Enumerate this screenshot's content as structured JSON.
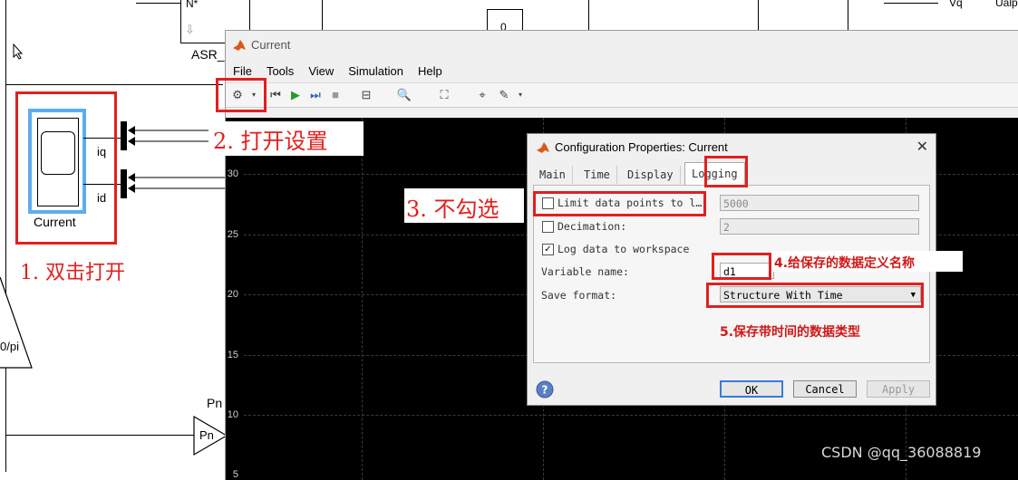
{
  "model": {
    "top_labels": {
      "n_port": "N*",
      "asr_label": "ASR_",
      "block_value": "0",
      "vq_port": "Vq",
      "ualpha": "Ualp"
    },
    "scope_block": {
      "label": "Current",
      "in_iq": "iq",
      "in_id": "id"
    },
    "gain_block": {
      "text": "0/pi"
    },
    "pn_block": {
      "label": "Pn",
      "text": "Pn"
    }
  },
  "scope_window": {
    "title": "Current",
    "menu": [
      "File",
      "Tools",
      "View",
      "Simulation",
      "Help"
    ],
    "yticks": [
      "30",
      "25",
      "20",
      "15",
      "10",
      "5"
    ]
  },
  "dialog": {
    "title": "Configuration Properties: Current",
    "tabs": [
      "Main",
      "Time",
      "Display",
      "Logging"
    ],
    "active_tab": "Logging",
    "limit_label": "Limit data points to l…",
    "limit_value": "5000",
    "decimation_label": "Decimation:",
    "decimation_value": "2",
    "log_label": "Log data to workspace",
    "varname_label": "Variable name:",
    "varname_value": "d1",
    "format_label": "Save format:",
    "format_value": "Structure With Time",
    "ok": "OK",
    "cancel": "Cancel",
    "apply": "Apply"
  },
  "annotations": {
    "a1": "1. 双击打开",
    "a2": "2. 打开设置",
    "a3": "3. 不勾选",
    "a4": "4.给保存的数据定义名称",
    "a5": "5.保存带时间的数据类型"
  },
  "watermark": "CSDN @qq_36088819",
  "colors": {
    "annotation_red": "#e02020",
    "plot_bg": "#000000"
  }
}
